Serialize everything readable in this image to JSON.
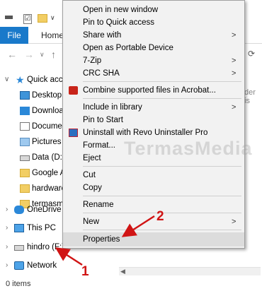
{
  "explorer": {
    "ribbon_tabs": {
      "file": "File",
      "home": "Home"
    },
    "nav_icons": [
      "back-arrow-icon",
      "forward-arrow-icon",
      "recent-dropdown-icon",
      "up-arrow-icon",
      "refresh-icon"
    ],
    "nav_glyphs": {
      "back": "←",
      "forward": "→",
      "history": "∨",
      "up": "↑",
      "refresh": "⟳",
      "check": "☑",
      "qa_arrow": "∨"
    },
    "nav_pane": {
      "quick_access": "Quick acces",
      "items": [
        "Desktop",
        "Download",
        "Documen",
        "Pictures",
        "Data (D:)",
        "Google Ac",
        "hardware",
        "termasme"
      ],
      "onedrive": "OneDrive",
      "this_pc": "This PC",
      "drive_f": "hindro (F:)",
      "network": "Network"
    },
    "content_note": "der is",
    "status": "0 items"
  },
  "context_menu": {
    "items": [
      {
        "label": "Open in new window"
      },
      {
        "label": "Pin to Quick access"
      },
      {
        "label": "Share with",
        "submenu": true
      },
      {
        "label": "Open as Portable Device"
      },
      {
        "label": "7-Zip",
        "submenu": true
      },
      {
        "label": "CRC SHA",
        "submenu": true
      },
      {
        "label": "Combine supported files in Acrobat..."
      },
      {
        "label": "Include in library",
        "submenu": true
      },
      {
        "label": "Pin to Start"
      },
      {
        "label": "Uninstall with Revo Uninstaller Pro"
      },
      {
        "label": "Format..."
      },
      {
        "label": "Eject"
      },
      {
        "label": "Cut"
      },
      {
        "label": "Copy"
      },
      {
        "label": "Rename"
      },
      {
        "label": "New",
        "submenu": true
      },
      {
        "label": "Properties",
        "highlighted": true
      }
    ],
    "submenu_glyph": ">"
  },
  "annotations": {
    "watermark": "TermasMedia",
    "step1": "1",
    "step2": "2",
    "arrow_color": "#d01414"
  },
  "colors": {
    "file_tab": "#1979ca",
    "menu_bg": "#f2f2f2",
    "highlight": "#dcdcdc"
  }
}
